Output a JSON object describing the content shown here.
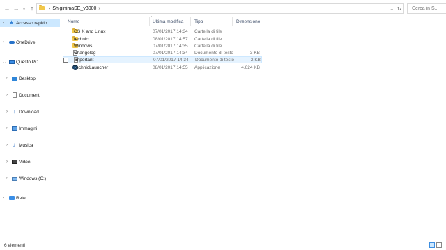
{
  "address": {
    "crumb": "ShiginimaSE_v3000",
    "search_placeholder": "Cerca in S..."
  },
  "nav": {
    "items": [
      {
        "label": "Accesso rapido",
        "icon": "star-icon",
        "selected": true
      },
      {
        "label": "OneDrive",
        "icon": "onedrive-icon"
      },
      {
        "label": "Questo PC",
        "icon": "computer-icon"
      },
      {
        "label": "Desktop",
        "icon": "desktop-icon"
      },
      {
        "label": "Documenti",
        "icon": "documents-icon"
      },
      {
        "label": "Download",
        "icon": "download-icon"
      },
      {
        "label": "Immagini",
        "icon": "pictures-icon"
      },
      {
        "label": "Musica",
        "icon": "music-icon"
      },
      {
        "label": "Video",
        "icon": "video-icon"
      },
      {
        "label": "Windows (C:)",
        "icon": "drive-icon"
      },
      {
        "label": "Rete",
        "icon": "network-icon"
      }
    ]
  },
  "columns": {
    "name": "Nome",
    "modified": "Ultima modifica",
    "type": "Tipo",
    "size": "Dimensione"
  },
  "files": [
    {
      "name": "OS X and Linux",
      "modified": "07/01/2017 14:34",
      "type": "Cartella di file",
      "size": "",
      "icon": "folder-icon"
    },
    {
      "name": "technic",
      "modified": "08/01/2017 14:57",
      "type": "Cartella di file",
      "size": "",
      "icon": "folder-icon"
    },
    {
      "name": "Windows",
      "modified": "07/01/2017 14:35",
      "type": "Cartella di file",
      "size": "",
      "icon": "folder-icon"
    },
    {
      "name": "Changelog",
      "modified": "07/01/2017 14:34",
      "type": "Documento di testo",
      "size": "3 KB",
      "icon": "text-file-icon"
    },
    {
      "name": "Important",
      "modified": "07/01/2017 14:34",
      "type": "Documento di testo",
      "size": "2 KB",
      "icon": "text-file-icon",
      "hovered": true
    },
    {
      "name": "TechnicLauncher",
      "modified": "08/01/2017 14:55",
      "type": "Applicazione",
      "size": "4.624 KB",
      "icon": "app-icon"
    }
  ],
  "status": {
    "count": "6 elementi"
  },
  "colors": {
    "selection": "#cce8ff",
    "hover": "#e5f3ff",
    "folder": "#f2c84b"
  }
}
